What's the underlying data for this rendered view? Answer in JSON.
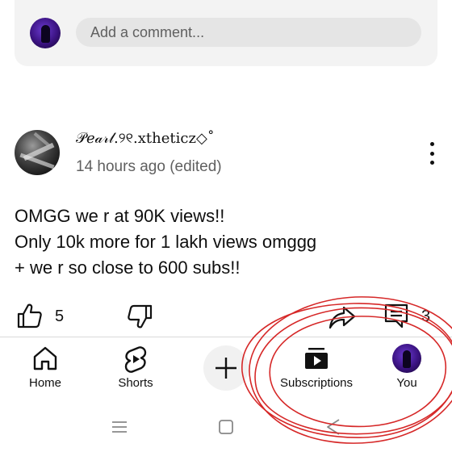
{
  "comment_composer": {
    "placeholder": "Add a comment..."
  },
  "comment": {
    "author": "𝒫𝑒𝒶𝓇𝓁.୨୧.xtheticz◇˚",
    "timestamp": "14 hours ago (edited)",
    "body_lines": [
      "OMGG we r at 90K views!!",
      "Only 10k more for 1 lakh views omggg",
      "+ we r so close to 600 subs!!"
    ],
    "like_count": "5",
    "reply_count": "3"
  },
  "bottom_nav": {
    "home": "Home",
    "shorts": "Shorts",
    "subscriptions": "Subscriptions",
    "you": "You"
  },
  "icons": {
    "like": "thumbs-up-icon",
    "dislike": "thumbs-down-icon",
    "share": "share-icon",
    "reply": "comment-icon",
    "home": "home-icon",
    "shorts": "shorts-icon",
    "create": "plus-icon",
    "subscriptions": "subscriptions-icon"
  },
  "colors": {
    "annotation_circle": "#d62828",
    "avatar_purple": "#3a1280"
  }
}
